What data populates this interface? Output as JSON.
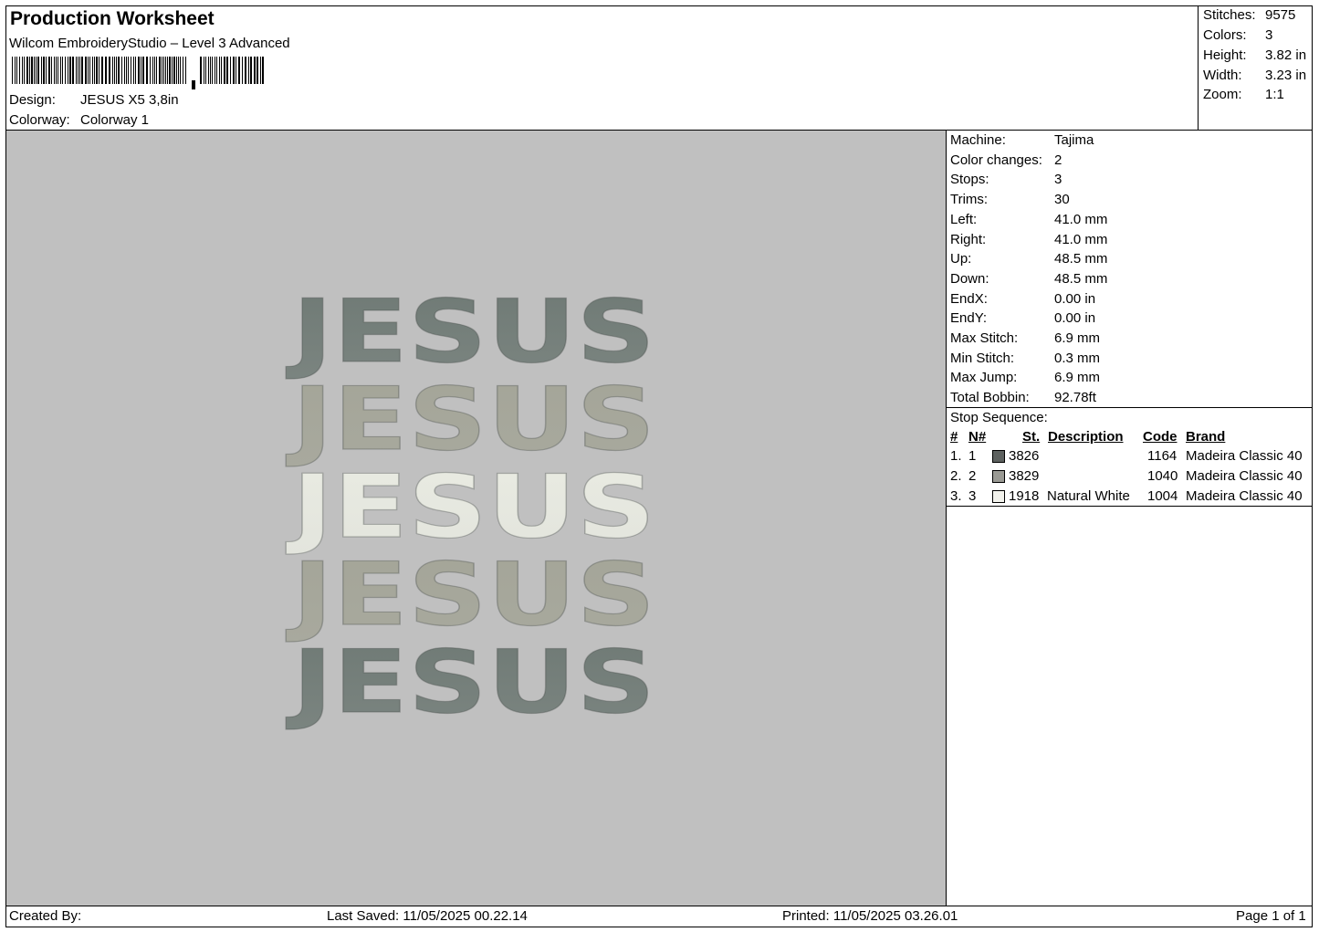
{
  "header": {
    "title": "Production Worksheet",
    "software": "Wilcom EmbroideryStudio – Level 3 Advanced",
    "design_label": "Design:",
    "design_value": "JESUS X5 3,8in",
    "colorway_label": "Colorway:",
    "colorway_value": "Colorway 1"
  },
  "summary": {
    "stitches_label": "Stitches:",
    "stitches": "9575",
    "colors_label": "Colors:",
    "colors": "3",
    "height_label": "Height:",
    "height": "3.82 in",
    "width_label": "Width:",
    "width": "3.23 in",
    "zoom_label": "Zoom:",
    "zoom": "1:1"
  },
  "machine": [
    {
      "label": "Machine:",
      "value": "Tajima"
    },
    {
      "label": "Color changes:",
      "value": "2"
    },
    {
      "label": "Stops:",
      "value": "3"
    },
    {
      "label": "Trims:",
      "value": "30"
    },
    {
      "label": "Left:",
      "value": "41.0 mm"
    },
    {
      "label": "Right:",
      "value": "41.0 mm"
    },
    {
      "label": "Up:",
      "value": "48.5 mm"
    },
    {
      "label": "Down:",
      "value": "48.5 mm"
    },
    {
      "label": "EndX:",
      "value": "0.00 in"
    },
    {
      "label": "EndY:",
      "value": "0.00 in"
    },
    {
      "label": "Max Stitch:",
      "value": "6.9 mm"
    },
    {
      "label": "Min Stitch:",
      "value": "0.3 mm"
    },
    {
      "label": "Max Jump:",
      "value": "6.9 mm"
    },
    {
      "label": "Total Bobbin:",
      "value": "92.78ft"
    }
  ],
  "stop_sequence": {
    "title": "Stop Sequence:",
    "headers": {
      "num": "#",
      "n": "N#",
      "st": "St.",
      "description": "Description",
      "code": "Code",
      "brand": "Brand"
    },
    "rows": [
      {
        "num": "1.",
        "n": "1",
        "swatch": "#5d615f",
        "st": "3826",
        "description": "",
        "code": "1164",
        "brand": "Madeira Classic 40"
      },
      {
        "num": "2.",
        "n": "2",
        "swatch": "#9a9a94",
        "st": "3829",
        "description": "",
        "code": "1040",
        "brand": "Madeira Classic 40"
      },
      {
        "num": "3.",
        "n": "3",
        "swatch": "#f2f2ec",
        "st": "1918",
        "description": "Natural White",
        "code": "1004",
        "brand": "Madeira Classic 40"
      }
    ]
  },
  "design": {
    "background": "#c0c0c0",
    "word": "JESUS",
    "row_colors": [
      "#6f7a75",
      "#a4a598",
      "#e9ebe2",
      "#a4a598",
      "#6f7a75"
    ]
  },
  "footer": {
    "created_by": "Created By:",
    "last_saved": "Last Saved: 11/05/2025 00.22.14",
    "printed": "Printed: 11/05/2025 03.26.01",
    "page": "Page 1 of 1"
  }
}
